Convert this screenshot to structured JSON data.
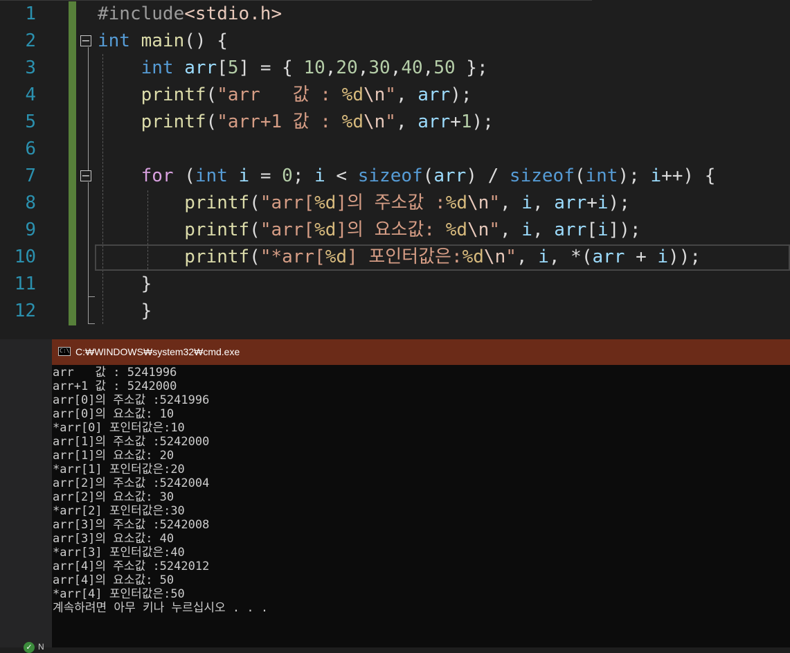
{
  "editor": {
    "line_numbers": [
      "1",
      "2",
      "3",
      "4",
      "5",
      "6",
      "7",
      "8",
      "9",
      "10",
      "11",
      "12"
    ],
    "lines": [
      [
        [
          "inc",
          "#include"
        ],
        [
          "incf",
          "<stdio.h>"
        ]
      ],
      [
        [
          "kw",
          "int"
        ],
        [
          "pun",
          " "
        ],
        [
          "fn",
          "main"
        ],
        [
          "pun",
          "() {"
        ]
      ],
      [
        [
          "pun",
          "    "
        ],
        [
          "kw",
          "int"
        ],
        [
          "pun",
          " "
        ],
        [
          "var",
          "arr"
        ],
        [
          "pun",
          "["
        ],
        [
          "num",
          "5"
        ],
        [
          "pun",
          "] = { "
        ],
        [
          "num",
          "10"
        ],
        [
          "pun",
          ","
        ],
        [
          "num",
          "20"
        ],
        [
          "pun",
          ","
        ],
        [
          "num",
          "30"
        ],
        [
          "pun",
          ","
        ],
        [
          "num",
          "40"
        ],
        [
          "pun",
          ","
        ],
        [
          "num",
          "50"
        ],
        [
          "pun",
          " };"
        ]
      ],
      [
        [
          "pun",
          "    "
        ],
        [
          "fn",
          "printf"
        ],
        [
          "pun",
          "("
        ],
        [
          "str",
          "\"arr   값 : "
        ],
        [
          "fmt",
          "%d"
        ],
        [
          "esc",
          "\\n"
        ],
        [
          "str",
          "\""
        ],
        [
          "pun",
          ", "
        ],
        [
          "var",
          "arr"
        ],
        [
          "pun",
          ");"
        ]
      ],
      [
        [
          "pun",
          "    "
        ],
        [
          "fn",
          "printf"
        ],
        [
          "pun",
          "("
        ],
        [
          "str",
          "\"arr+1 값 : "
        ],
        [
          "fmt",
          "%d"
        ],
        [
          "esc",
          "\\n"
        ],
        [
          "str",
          "\""
        ],
        [
          "pun",
          ", "
        ],
        [
          "var",
          "arr"
        ],
        [
          "pun",
          "+"
        ],
        [
          "num",
          "1"
        ],
        [
          "pun",
          ");"
        ]
      ],
      [],
      [
        [
          "pun",
          "    "
        ],
        [
          "kwc",
          "for"
        ],
        [
          "pun",
          " ("
        ],
        [
          "kw",
          "int"
        ],
        [
          "pun",
          " "
        ],
        [
          "var",
          "i"
        ],
        [
          "pun",
          " = "
        ],
        [
          "num",
          "0"
        ],
        [
          "pun",
          "; "
        ],
        [
          "var",
          "i"
        ],
        [
          "pun",
          " < "
        ],
        [
          "kw",
          "sizeof"
        ],
        [
          "pun",
          "("
        ],
        [
          "var",
          "arr"
        ],
        [
          "pun",
          ") / "
        ],
        [
          "kw",
          "sizeof"
        ],
        [
          "pun",
          "("
        ],
        [
          "kw",
          "int"
        ],
        [
          "pun",
          "); "
        ],
        [
          "var",
          "i"
        ],
        [
          "pun",
          "++) {"
        ]
      ],
      [
        [
          "pun",
          "        "
        ],
        [
          "fn",
          "printf"
        ],
        [
          "pun",
          "("
        ],
        [
          "str",
          "\"arr["
        ],
        [
          "fmt",
          "%d"
        ],
        [
          "str",
          "]의 주소값 :"
        ],
        [
          "fmt",
          "%d"
        ],
        [
          "esc",
          "\\n"
        ],
        [
          "str",
          "\""
        ],
        [
          "pun",
          ", "
        ],
        [
          "var",
          "i"
        ],
        [
          "pun",
          ", "
        ],
        [
          "var",
          "arr"
        ],
        [
          "pun",
          "+"
        ],
        [
          "var",
          "i"
        ],
        [
          "pun",
          ");"
        ]
      ],
      [
        [
          "pun",
          "        "
        ],
        [
          "fn",
          "printf"
        ],
        [
          "pun",
          "("
        ],
        [
          "str",
          "\"arr["
        ],
        [
          "fmt",
          "%d"
        ],
        [
          "str",
          "]의 요소값: "
        ],
        [
          "fmt",
          "%d"
        ],
        [
          "esc",
          "\\n"
        ],
        [
          "str",
          "\""
        ],
        [
          "pun",
          ", "
        ],
        [
          "var",
          "i"
        ],
        [
          "pun",
          ", "
        ],
        [
          "var",
          "arr"
        ],
        [
          "pun",
          "["
        ],
        [
          "var",
          "i"
        ],
        [
          "pun",
          "]);"
        ]
      ],
      [
        [
          "pun",
          "        "
        ],
        [
          "fn",
          "printf"
        ],
        [
          "pun",
          "("
        ],
        [
          "str",
          "\"*arr["
        ],
        [
          "fmt",
          "%d"
        ],
        [
          "str",
          "] 포인터값은:"
        ],
        [
          "fmt",
          "%d"
        ],
        [
          "esc",
          "\\n"
        ],
        [
          "str",
          "\""
        ],
        [
          "pun",
          ", "
        ],
        [
          "var",
          "i"
        ],
        [
          "pun",
          ", *("
        ],
        [
          "var",
          "arr"
        ],
        [
          "pun",
          " + "
        ],
        [
          "var",
          "i"
        ],
        [
          "pun",
          "));"
        ]
      ],
      [
        [
          "pun",
          "    }"
        ]
      ],
      [
        [
          "pun",
          "    }"
        ]
      ]
    ]
  },
  "console": {
    "title": "C:₩WINDOWS₩system32₩cmd.exe",
    "icon": "C:\\",
    "lines": [
      "arr   값 : 5241996",
      "arr+1 값 : 5242000",
      "arr[0]의 주소값 :5241996",
      "arr[0]의 요소값: 10",
      "*arr[0] 포인터값은:10",
      "arr[1]의 주소값 :5242000",
      "arr[1]의 요소값: 20",
      "*arr[1] 포인터값은:20",
      "arr[2]의 주소값 :5242004",
      "arr[2]의 요소값: 30",
      "*arr[2] 포인터값은:30",
      "arr[3]의 주소값 :5242008",
      "arr[3]의 요소값: 40",
      "*arr[3] 포인터값은:40",
      "arr[4]의 주소값 :5242012",
      "arr[4]의 요소값: 50",
      "*arr[4] 포인터값은:50",
      "계속하려면 아무 키나 누르십시오 . . ."
    ]
  },
  "status": {
    "icon": "check-circle-icon",
    "text": "N"
  }
}
